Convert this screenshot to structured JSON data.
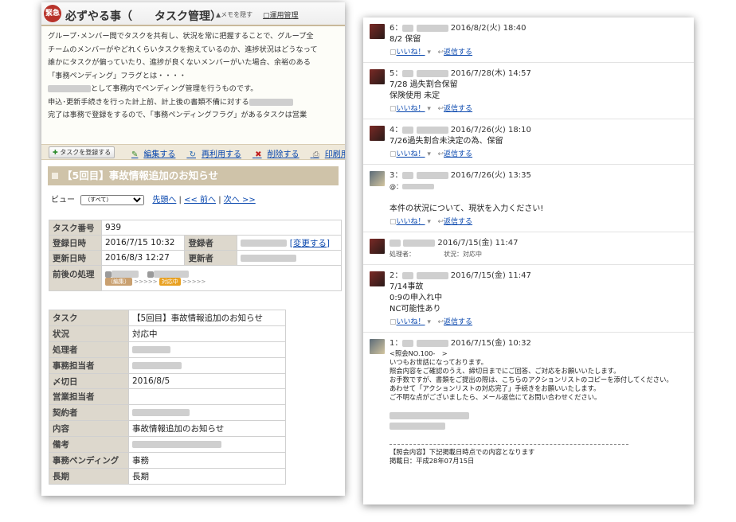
{
  "left": {
    "seal": "緊急",
    "title": "必ずやる事（　　タスク管理）",
    "hide_memo": "メモを隠す",
    "rules_link": "運用管理",
    "desc_lines": [
      "グループ･メンバー間でタスクを共有し、状況を常に把握することで、グループ全",
      "チームのメンバーがやどれくらいタスクを抱えているのか、進捗状況はどうなって",
      "誰かにタスクが偏っていたり、進捗が良くないメンバーがいた場合、余裕のある",
      "",
      "「事務ペンディング」フラグとは・・・・",
      "として事務内でペンディング管理を行うものです。",
      "申込･更新手続きを行った計上前、計上後の書類不備に対する",
      "完了は事務で登録をするので、「事務ペンディングフラグ」があるタスクは営業"
    ],
    "toolbar": {
      "register": "タスクを登録する",
      "edit": "編集する",
      "reuse": "再利用する",
      "delete": "削除する",
      "print": "印刷用画面"
    },
    "task_heading": "【5回目】事故情報追加のお知らせ",
    "view": {
      "label": "ビュー",
      "select": "（すべて）",
      "first": "先頭へ",
      "prev": "<< 前へ",
      "next": "次へ >>"
    },
    "meta": {
      "task_no_label": "タスク番号",
      "task_no": "939",
      "reg_date_label": "登録日時",
      "reg_date": "2016/7/15 10:32",
      "registrant_label": "登録者",
      "change_link": "[変更する]",
      "upd_date_label": "更新日時",
      "upd_date": "2016/8/3 12:27",
      "updater_label": "更新者",
      "process_label": "前後の処理",
      "badge_edit": "（編集）",
      "badge_active": "対応中",
      "arrows": ">>>>>"
    },
    "detail": [
      {
        "label": "タスク",
        "value": "【5回目】事故情報追加のお知らせ"
      },
      {
        "label": "状況",
        "value": "対応中"
      },
      {
        "label": "処理者",
        "value": ""
      },
      {
        "label": "事務担当者",
        "value": ""
      },
      {
        "label": "〆切日",
        "value": "2016/8/5"
      },
      {
        "label": "営業担当者",
        "value": ""
      },
      {
        "label": "契約者",
        "value": ""
      },
      {
        "label": "内容",
        "value": "事故情報追加のお知らせ"
      },
      {
        "label": "備考",
        "value": ""
      },
      {
        "label": "事務ペンディング",
        "value": "事務"
      },
      {
        "label": "長期",
        "value": "長期"
      }
    ]
  },
  "right": {
    "like": "いいね！",
    "reply": "返信する",
    "posts": [
      {
        "no": "6：",
        "date": "2016/8/2(火) 18:40",
        "body": [
          "8/2 保留"
        ]
      },
      {
        "no": "5：",
        "date": "2016/7/28(木) 14:57",
        "body": [
          "7/28 過失割合保留",
          "保険使用 未定"
        ]
      },
      {
        "no": "4：",
        "date": "2016/7/26(火) 18:10",
        "body": [
          "7/26過失割合未決定の為、保留"
        ]
      },
      {
        "no": "3：",
        "date": "2016/7/26(火) 13:35",
        "body": [
          "@：",
          "",
          "本件の状況について、現状を入力ください!"
        ]
      },
      {
        "no": "",
        "date": "2016/7/15(金) 11:47",
        "note": "処理者：　　　　　状況：対応中"
      },
      {
        "no": "2：",
        "date": "2016/7/15(金) 11:47",
        "body": [
          "7/14事故",
          "0:9の申入れ中",
          "NC可能性あり"
        ]
      },
      {
        "no": "1：",
        "date": "2016/7/15(金) 10:32",
        "body": [
          "<照会NO.100-　>",
          "いつもお世話になっております。",
          "照会内容をご確認のうえ、締切日までにご回答、ご対応をお願いいたします。",
          "お手数ですが、書類をご提出の際は、こちらのアクションリストのコピーを添付してください。",
          "あわせて「アクションリストの対応完了」手続きをお願いいたします。",
          "ご不明な点がございましたら、メール返信にてお問い合わせください。"
        ]
      },
      {
        "footer": [
          "【照会内容】下記掲載日時点での内容となります",
          "掲載日：平成28年07月15日"
        ]
      }
    ]
  }
}
